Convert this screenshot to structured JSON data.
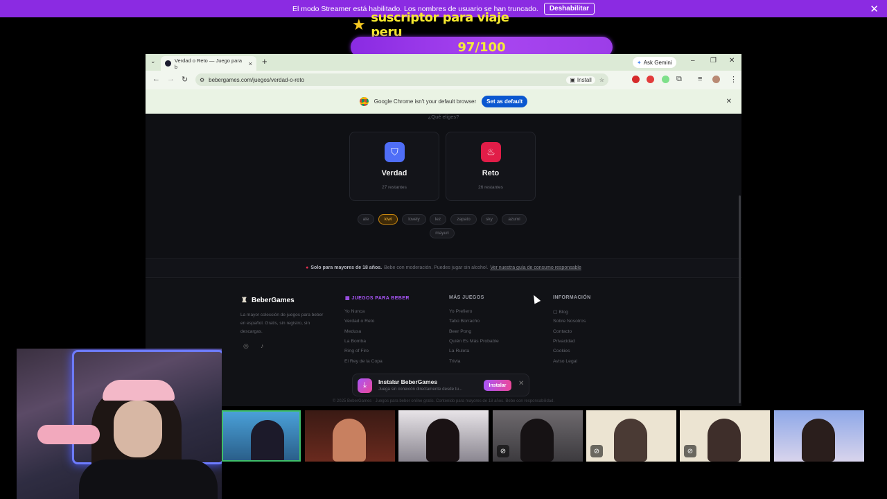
{
  "twitch": {
    "banner_text": "El modo Streamer está habilitado. Los nombres de usuario se han truncado.",
    "banner_button": "Deshabilitar",
    "close_glyph": "✕"
  },
  "goal": {
    "title": "suscriptor para viaje peru",
    "progress_text": "97/100",
    "current": 97,
    "target": 100
  },
  "browser": {
    "tab_title": "Verdad o Reto — Juego para b",
    "url": "bebergames.com/juegos/verdad-o-reto",
    "install_label": "Install",
    "gemini_label": "Ask Gemini",
    "infobar_text": "Google Chrome isn't your default browser",
    "infobar_button": "Set as default"
  },
  "page": {
    "question": "¿Qué eliges?",
    "choices": [
      {
        "title": "Verdad",
        "remaining": "27 restantes",
        "color": "#4f6ef7",
        "icon": "shield-icon"
      },
      {
        "title": "Reto",
        "remaining": "26 restantes",
        "color": "#e11d48",
        "icon": "flame-icon"
      }
    ],
    "players": [
      "ale",
      "kiwi",
      "lovely",
      "lez",
      "zapato",
      "sky",
      "azumi",
      "mayuri"
    ],
    "active_player": "kiwi",
    "disclaimer_bold": "Solo para mayores de 18 años.",
    "disclaimer_text": "Bebe con moderación. Puedes jugar sin alcohol.",
    "disclaimer_link": "Ver nuestra guía de consumo responsable"
  },
  "footer": {
    "brand": "BeberGames",
    "description": "La mayor colección de juegos para beber en español. Gratis, sin registro, sin descargas.",
    "columns": [
      {
        "heading": "JUEGOS PARA BEBER",
        "links": [
          "Yo Nunca",
          "Verdad o Reto",
          "Medusa",
          "La Bomba",
          "Ring of Fire",
          "El Rey de la Copa"
        ]
      },
      {
        "heading": "MÁS JUEGOS",
        "links": [
          "Yo Prefiero",
          "Tabú Borracho",
          "Beer Pong",
          "Quién Es Más Probable",
          "La Ruleta",
          "Trivia"
        ]
      },
      {
        "heading": "INFORMACIÓN",
        "links": [
          "Blog",
          "Sobre Nosotros",
          "Contacto",
          "Privacidad",
          "Cookies",
          "Aviso Legal"
        ]
      }
    ],
    "copyright": "© 2025 BeberGames · Juegos para beber online gratis. Contenido para mayores de 18 años. Bebe con responsabilidad."
  },
  "toast": {
    "title": "Instalar BeberGames",
    "subtitle": "Juega sin conexión directamente desde tu...",
    "button": "Instalar"
  }
}
